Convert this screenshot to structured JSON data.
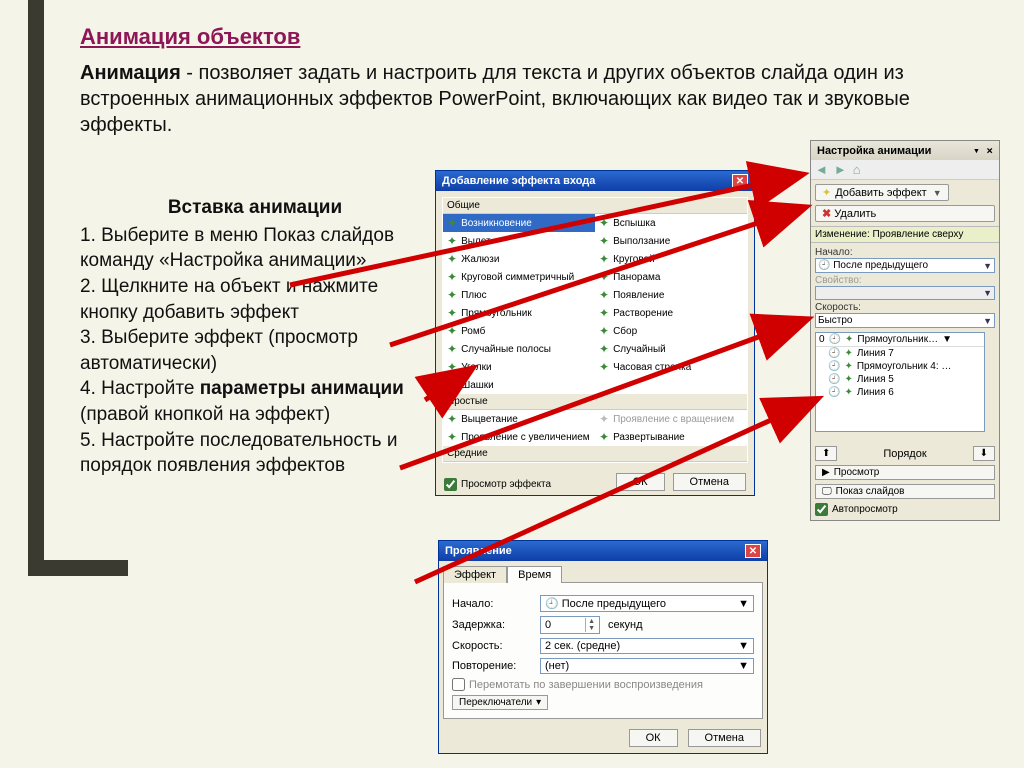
{
  "slide": {
    "title": "Анимация объектов",
    "intro_bold": "Анимация",
    "intro_rest": " - позволяет задать и настроить для текста и других объектов слайда один из встроенных анимационных эффектов PowerPoint, включающих как видео так и звуковые эффекты."
  },
  "instructions": {
    "heading": "Вставка анимации",
    "step1": "1. Выберите в меню Показ слайдов команду «Настройка анимации»",
    "step2": "2. Щелкните на объект и нажмите кнопку добавить эффект",
    "step3": "3. Выберите эффект (просмотр автоматически)",
    "step4a": "4. Настройте ",
    "step4b": "параметры анимации",
    "step4c": " (правой кнопкой на эффект)",
    "step5": "5. Настройте последовательность и порядок появления эффектов"
  },
  "pane": {
    "title": "Настройка анимации",
    "add": "Добавить эффект",
    "remove": "Удалить",
    "change_label": "Изменение: Проявление сверху",
    "start_label": "Начало:",
    "start_value": "После предыдущего",
    "prop_label": "Свойство:",
    "speed_label": "Скорость:",
    "speed_value": "Быстро",
    "list": {
      "index": "0",
      "first": "Прямоугольник…",
      "items": [
        "Линия 7",
        "Прямоугольник 4: …",
        "Линия 5",
        "Линия 6"
      ]
    },
    "order_label": "Порядок",
    "preview": "Просмотр",
    "slideshow": "Показ слайдов",
    "autopreview": "Автопросмотр"
  },
  "effect_dialog": {
    "title": "Добавление эффекта входа",
    "group1": "Общие",
    "effects1": [
      [
        "Возникновение",
        "Вспышка"
      ],
      [
        "Вылет",
        "Выползание"
      ],
      [
        "Жалюзи",
        "Круговой"
      ],
      [
        "Круговой симметричный",
        "Панорама"
      ],
      [
        "Плюс",
        "Появление"
      ],
      [
        "Прямоугольник",
        "Растворение"
      ],
      [
        "Ромб",
        "Сбор"
      ],
      [
        "Случайные полосы",
        "Случайный"
      ],
      [
        "Уголки",
        "Часовая стрелка"
      ],
      [
        "Шашки",
        ""
      ]
    ],
    "group2": "Простые",
    "effects2": [
      [
        "Выцветание",
        "Проявление с вращением"
      ],
      [
        "Проявление с увеличением",
        "Развертывание"
      ]
    ],
    "group3": "Средние",
    "preview_chk": "Просмотр эффекта",
    "ok": "ОК",
    "cancel": "Отмена"
  },
  "timing_dialog": {
    "title": "Проявление",
    "tab1": "Эффект",
    "tab2": "Время",
    "start_label": "Начало:",
    "start_value": "После предыдущего",
    "delay_label": "Задержка:",
    "delay_value": "0",
    "delay_unit": "секунд",
    "speed_label": "Скорость:",
    "speed_value": "2 сек. (средне)",
    "repeat_label": "Повторение:",
    "repeat_value": "(нет)",
    "rewind_chk": "Перемотать по завершении воспроизведения",
    "triggers": "Переключатели",
    "ok": "ОК",
    "cancel": "Отмена"
  }
}
